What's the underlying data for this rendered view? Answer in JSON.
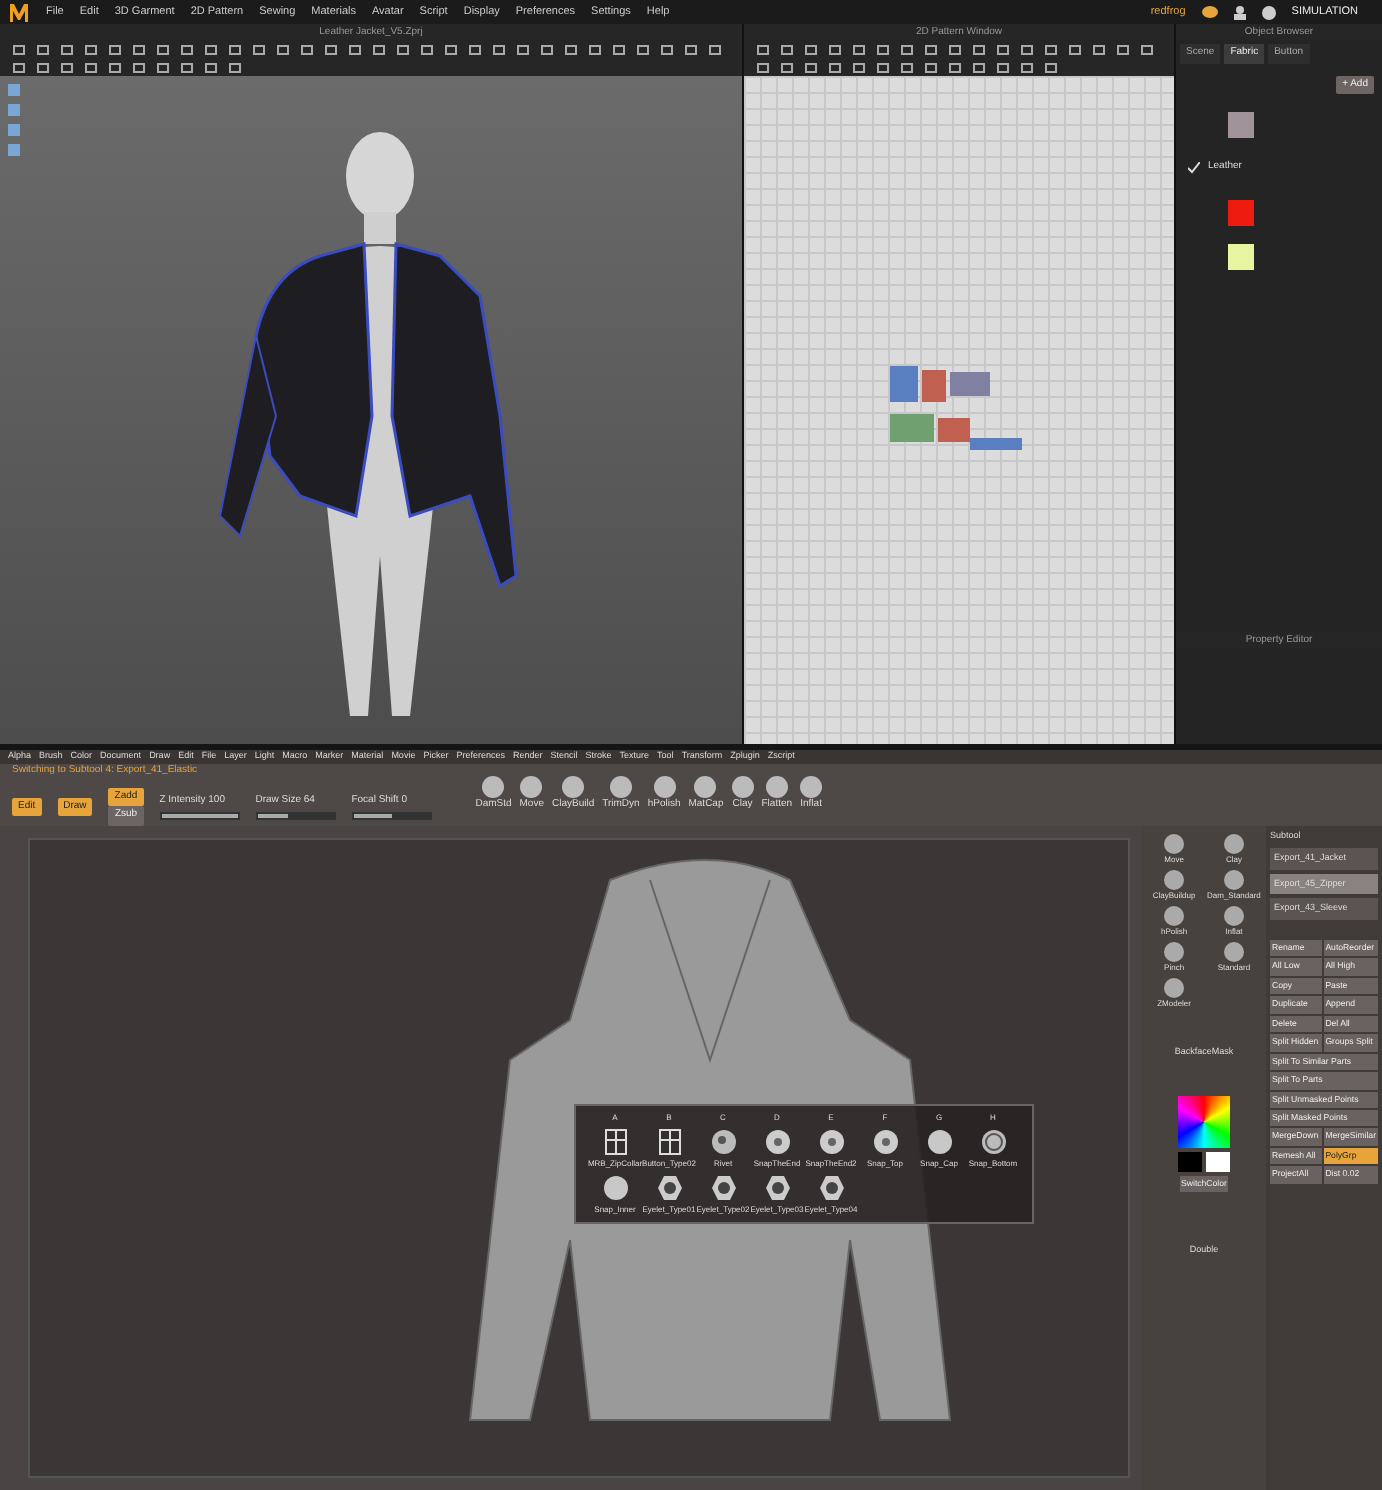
{
  "marvelous": {
    "menu": [
      "File",
      "Edit",
      "3D Garment",
      "2D Pattern",
      "Sewing",
      "Materials",
      "Avatar",
      "Script",
      "Display",
      "Preferences",
      "Settings",
      "Help"
    ],
    "user": "redfrog",
    "mode": "SIMULATION",
    "viewport": {
      "title": "Leather Jacket_V5.Zprj"
    },
    "pattern_window": {
      "title": "2D Pattern Window"
    },
    "object_browser": {
      "title": "Object Browser",
      "tabs": [
        {
          "label": "Scene",
          "selected": false
        },
        {
          "label": "Fabric",
          "selected": true
        },
        {
          "label": "Button",
          "selected": false
        }
      ],
      "add_button": "+ Add",
      "fabrics": [
        {
          "color": "#a1939a",
          "selected": false
        },
        {
          "name": "Leather",
          "selected": true
        },
        {
          "color": "#ee1c10",
          "selected": false
        },
        {
          "color": "#e8f5a0",
          "selected": false
        }
      ]
    },
    "property_editor": {
      "title": "Property Editor"
    }
  },
  "zbrush": {
    "menu": [
      "Alpha",
      "Brush",
      "Color",
      "Document",
      "Draw",
      "Edit",
      "File",
      "Layer",
      "Light",
      "Macro",
      "Marker",
      "Material",
      "Movie",
      "Picker",
      "Preferences",
      "Render",
      "Stencil",
      "Stroke",
      "Texture",
      "Tool",
      "Transform",
      "Zplugin",
      "Zscript"
    ],
    "status": "Switching to Subtool 4: Export_41_Elastic",
    "modes": [
      {
        "label": "Edit",
        "active": true
      },
      {
        "label": "Draw",
        "active": true
      }
    ],
    "zadd": {
      "label": "Zadd",
      "active": true
    },
    "zsub": {
      "label": "Zsub",
      "active": false
    },
    "sliders": [
      {
        "label": "Z Intensity 100",
        "level": 1.0
      },
      {
        "label": "Draw Size 64",
        "level": 0.4
      },
      {
        "label": "Focal Shift 0",
        "level": 0.5
      }
    ],
    "materials": [
      {
        "label": "DamStd"
      },
      {
        "label": "Move"
      },
      {
        "label": "ClayBuild"
      },
      {
        "label": "TrimDyn"
      },
      {
        "label": "hPolish"
      },
      {
        "label": "MatCap"
      },
      {
        "label": "Clay"
      },
      {
        "label": "Flatten"
      },
      {
        "label": "Inflat"
      }
    ],
    "popup": {
      "columns": [
        "A",
        "B",
        "C",
        "D",
        "E",
        "F",
        "G",
        "H"
      ],
      "items": [
        {
          "label": "MRB_ZipCollar",
          "kind": "frame"
        },
        {
          "label": "Button_Type02",
          "kind": "frame"
        },
        {
          "label": "Rivet",
          "kind": "rivet"
        },
        {
          "label": "SnapTheEnd",
          "kind": "snap"
        },
        {
          "label": "SnapTheEnd2",
          "kind": "snap"
        },
        {
          "label": "Snap_Top",
          "kind": "snap"
        },
        {
          "label": "Snap_Cap",
          "kind": "ball"
        },
        {
          "label": "Snap_Bottom",
          "kind": "ring"
        },
        {
          "label": "Snap_Inner",
          "kind": "ball"
        },
        {
          "label": "Eyelet_Type01",
          "kind": "eyelet"
        },
        {
          "label": "Eyelet_Type02",
          "kind": "eyelet"
        },
        {
          "label": "Eyelet_Type03",
          "kind": "eyelet"
        },
        {
          "label": "Eyelet_Type04",
          "kind": "eyelet"
        }
      ]
    },
    "brushes": [
      {
        "label": "Move"
      },
      {
        "label": "Clay"
      },
      {
        "label": "ClayBuildup"
      },
      {
        "label": "Dam_Standard"
      },
      {
        "label": "hPolish"
      },
      {
        "label": "Inflat"
      },
      {
        "label": "Pinch"
      },
      {
        "label": "Standard"
      },
      {
        "label": "ZModeler"
      }
    ],
    "backface": "BackfaceMask",
    "switch_color": "SwitchColor",
    "double": "Double",
    "subtool": {
      "title": "Subtool",
      "items": [
        {
          "name": "Export_41_Jacket",
          "selected": false
        },
        {
          "name": "Export_45_Zipper",
          "selected": true
        },
        {
          "name": "Export_43_Sleeve",
          "selected": false
        }
      ]
    },
    "tray_buttons": [
      {
        "label": "Rename",
        "wide": false,
        "active": false
      },
      {
        "label": "AutoReorder",
        "wide": false,
        "active": false
      },
      {
        "label": "All Low",
        "wide": false,
        "active": false
      },
      {
        "label": "All High",
        "wide": false,
        "active": false
      },
      {
        "label": "Copy",
        "wide": false,
        "active": false
      },
      {
        "label": "Paste",
        "wide": false,
        "active": false
      },
      {
        "label": "Duplicate",
        "wide": false,
        "active": false
      },
      {
        "label": "Append",
        "wide": false,
        "active": false
      },
      {
        "label": "Delete",
        "wide": false,
        "active": false
      },
      {
        "label": "Del All",
        "wide": false,
        "active": false
      },
      {
        "label": "Split Hidden",
        "wide": false,
        "active": false
      },
      {
        "label": "Groups Split",
        "wide": false,
        "active": false
      },
      {
        "label": "Split To Similar Parts",
        "wide": true,
        "active": false
      },
      {
        "label": "Split To Parts",
        "wide": true,
        "active": false
      },
      {
        "label": "Split Unmasked Points",
        "wide": true,
        "active": false
      },
      {
        "label": "Split Masked Points",
        "wide": true,
        "active": false
      },
      {
        "label": "MergeDown",
        "wide": false,
        "active": false
      },
      {
        "label": "MergeSimilar",
        "wide": false,
        "active": false
      },
      {
        "label": "Remesh All",
        "wide": false,
        "active": false
      },
      {
        "label": "PolyGrp",
        "wide": false,
        "active": true
      },
      {
        "label": "ProjectAll",
        "wide": false,
        "active": false
      },
      {
        "label": "Dist 0.02",
        "wide": false,
        "active": false
      }
    ]
  }
}
